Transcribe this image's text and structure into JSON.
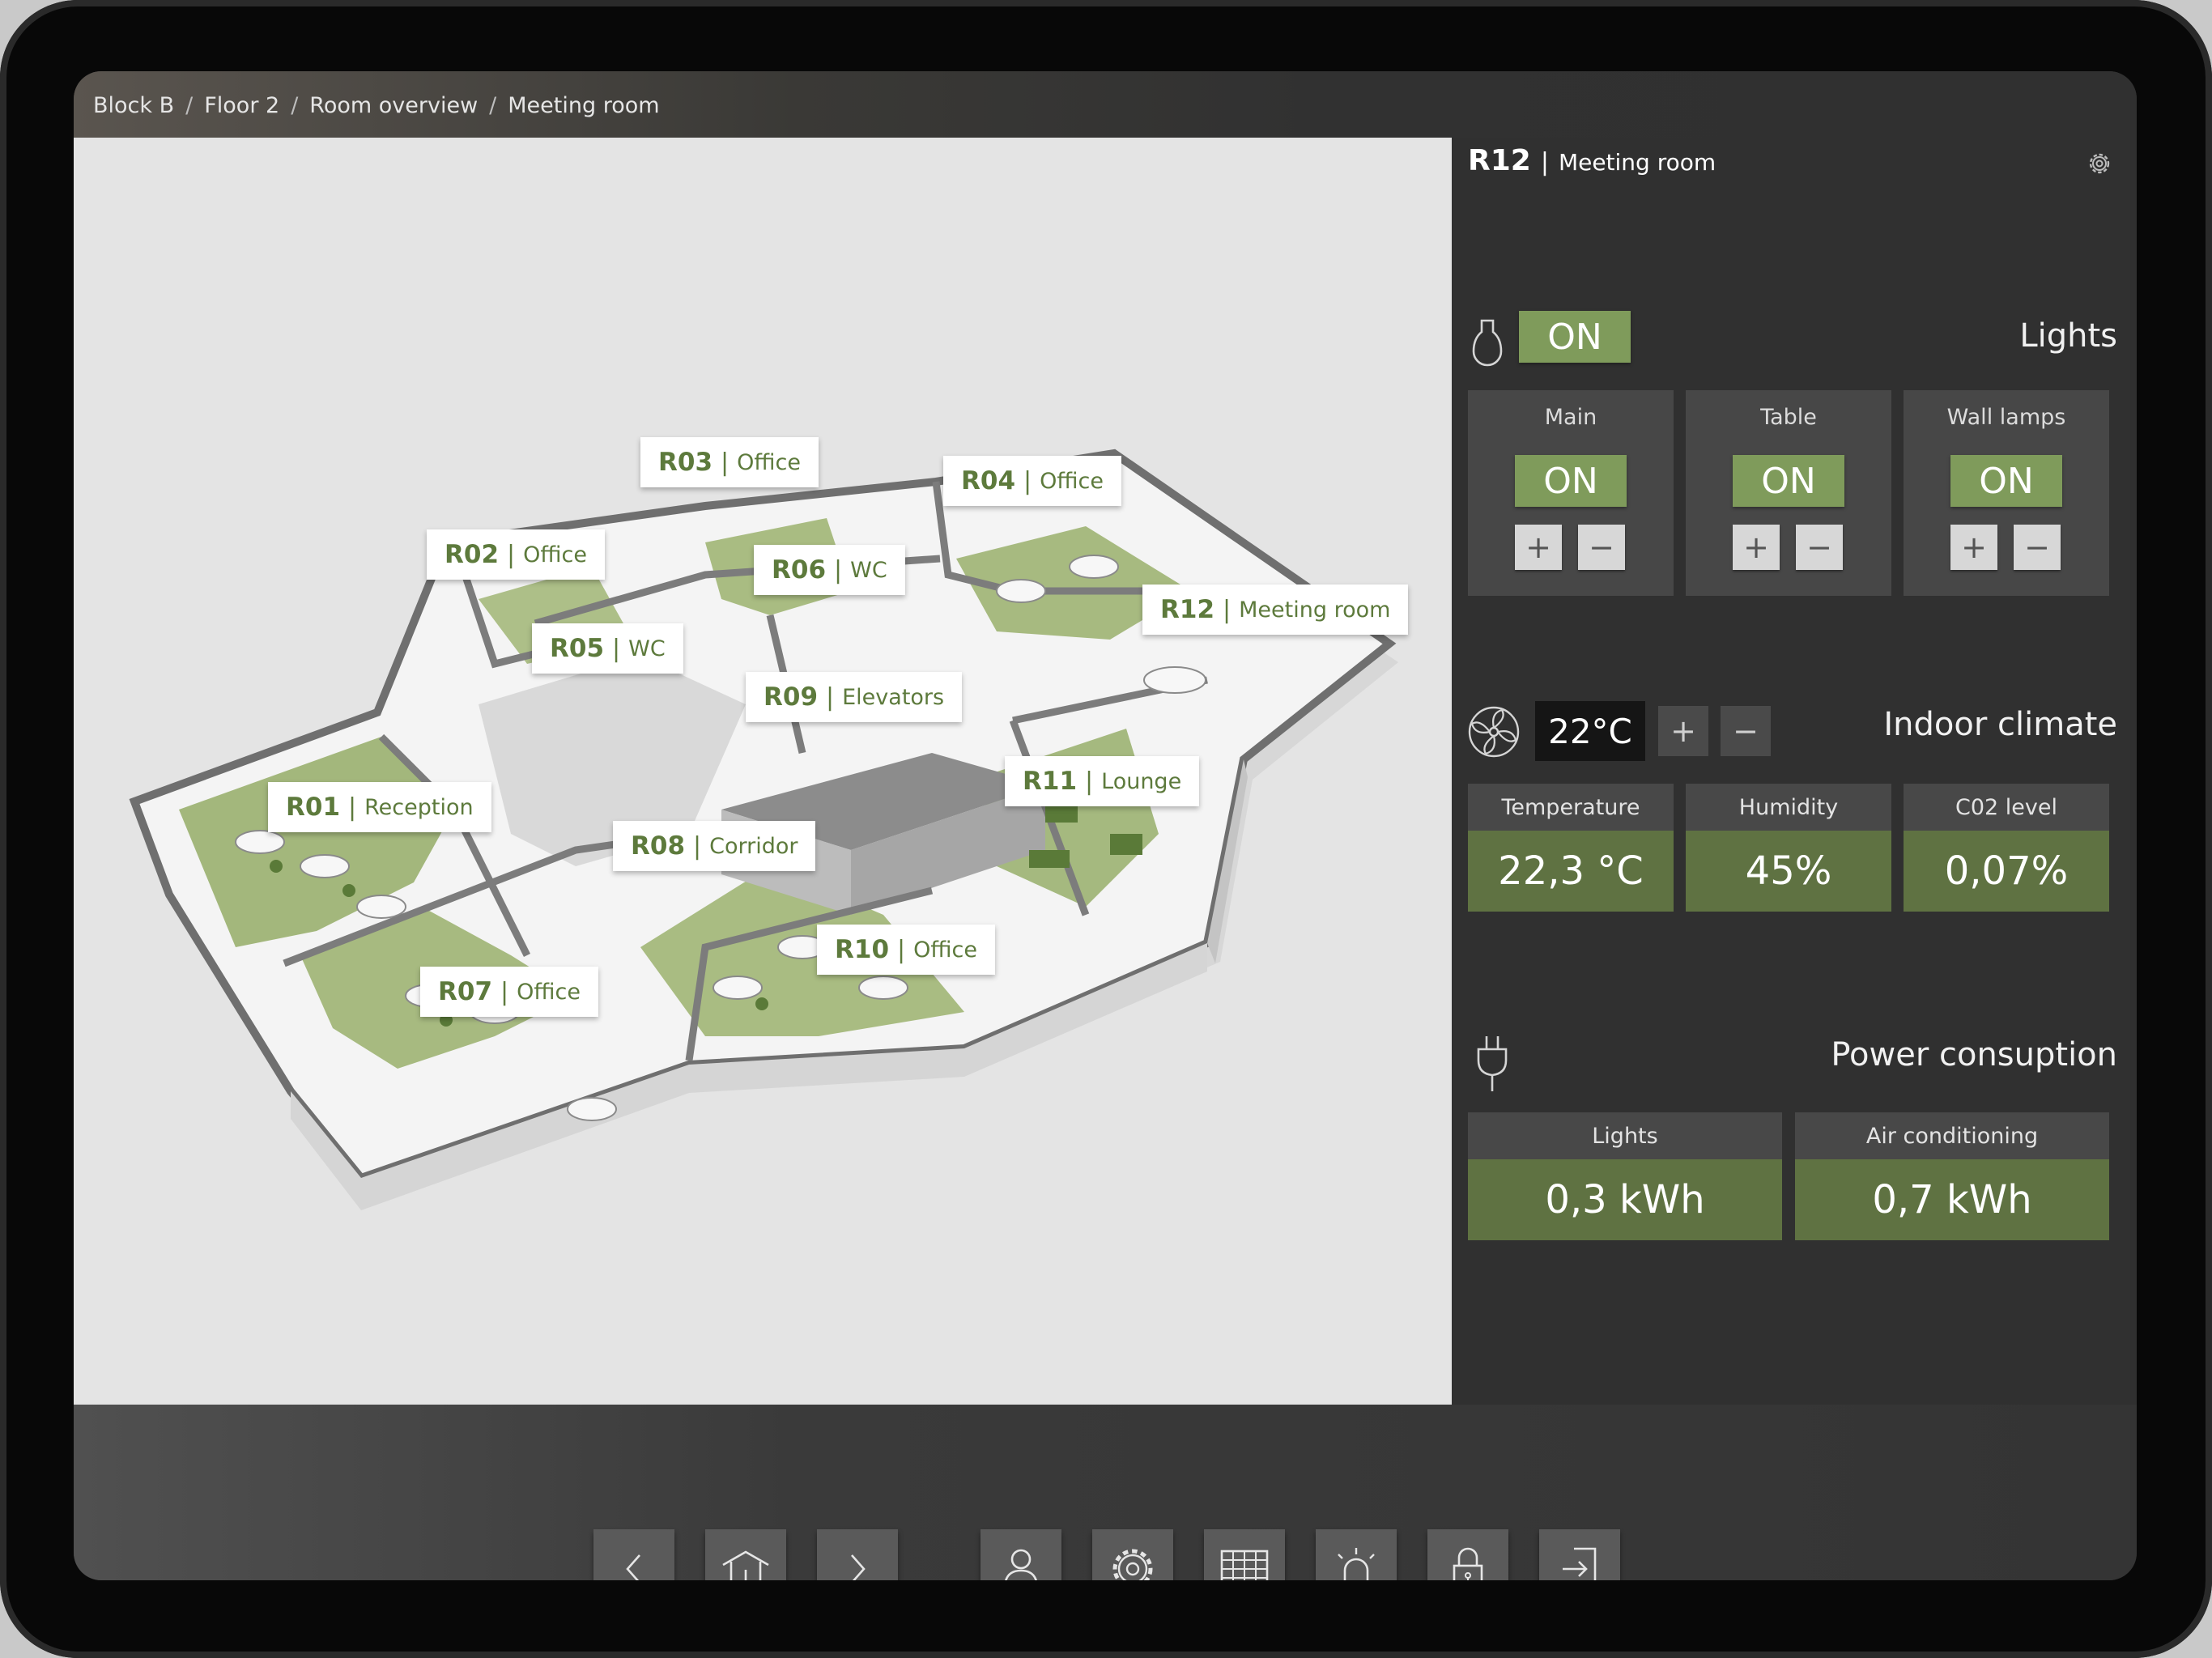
{
  "breadcrumb": [
    "Block B",
    "Floor 2",
    "Room overview",
    "Meeting room"
  ],
  "rooms": [
    {
      "code": "R01",
      "type": "Reception"
    },
    {
      "code": "R02",
      "type": "Office"
    },
    {
      "code": "R03",
      "type": "Office"
    },
    {
      "code": "R04",
      "type": "Office"
    },
    {
      "code": "R05",
      "type": "WC"
    },
    {
      "code": "R06",
      "type": "WC"
    },
    {
      "code": "R07",
      "type": "Office"
    },
    {
      "code": "R08",
      "type": "Corridor"
    },
    {
      "code": "R09",
      "type": "Elevators"
    },
    {
      "code": "R10",
      "type": "Office"
    },
    {
      "code": "R11",
      "type": "Lounge"
    },
    {
      "code": "R12",
      "type": "Meeting room"
    }
  ],
  "panel": {
    "room_code": "R12",
    "room_name": "Meeting room",
    "lights": {
      "title": "Lights",
      "master_state": "ON",
      "zones": [
        {
          "label": "Main",
          "state": "ON"
        },
        {
          "label": "Table",
          "state": "ON"
        },
        {
          "label": "Wall lamps",
          "state": "ON"
        }
      ]
    },
    "climate": {
      "title": "Indoor climate",
      "setpoint": "22°C",
      "metrics": [
        {
          "label": "Temperature",
          "value": "22,3 °C"
        },
        {
          "label": "Humidity",
          "value": "45%"
        },
        {
          "label": "C02 level",
          "value": "0,07%"
        }
      ]
    },
    "power": {
      "title": "Power consuption",
      "metrics": [
        {
          "label": "Lights",
          "value": "0,3 kWh"
        },
        {
          "label": "Air conditioning",
          "value": "0,7 kWh"
        }
      ]
    }
  },
  "symbols": {
    "plus": "+",
    "minus": "−",
    "bar": "|",
    "sep": "/"
  },
  "nav": [
    "back-icon",
    "home-icon",
    "forward-icon",
    "user-icon",
    "settings-icon",
    "grid-icon",
    "alarm-icon",
    "lock-icon",
    "logout-icon"
  ],
  "colors": {
    "accent_green": "#7f9b5b",
    "label_green": "#5d7a3c",
    "panel_bg": "#303030"
  }
}
